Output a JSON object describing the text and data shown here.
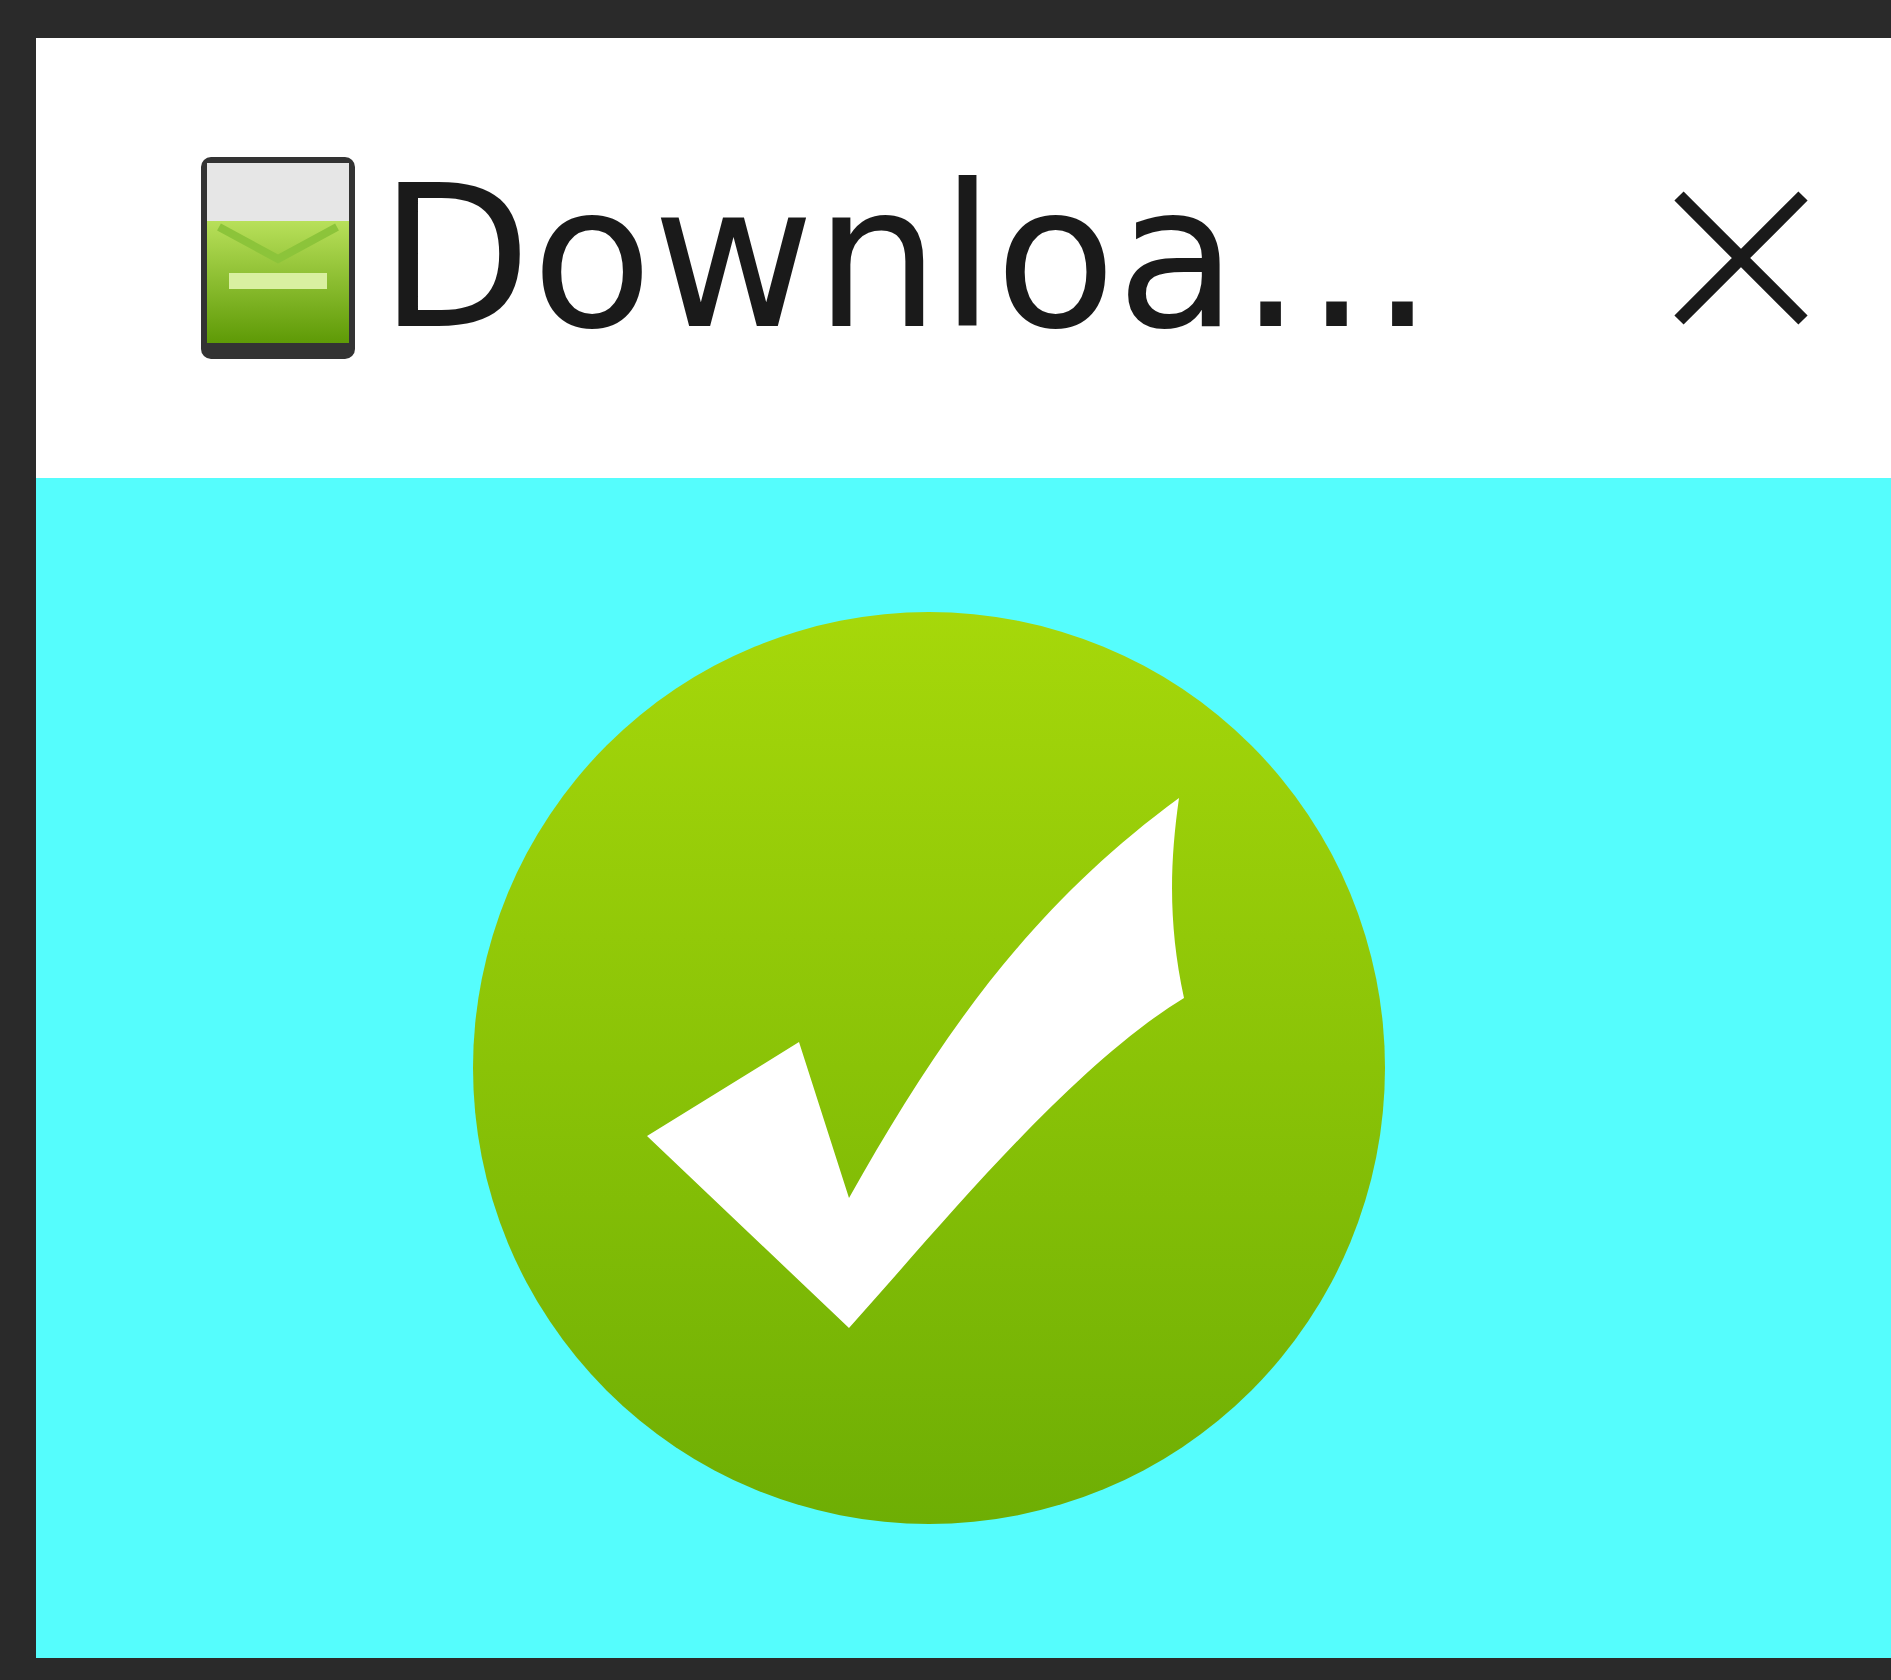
{
  "window": {
    "title": "Downloa…"
  },
  "status": {
    "kind": "success"
  }
}
